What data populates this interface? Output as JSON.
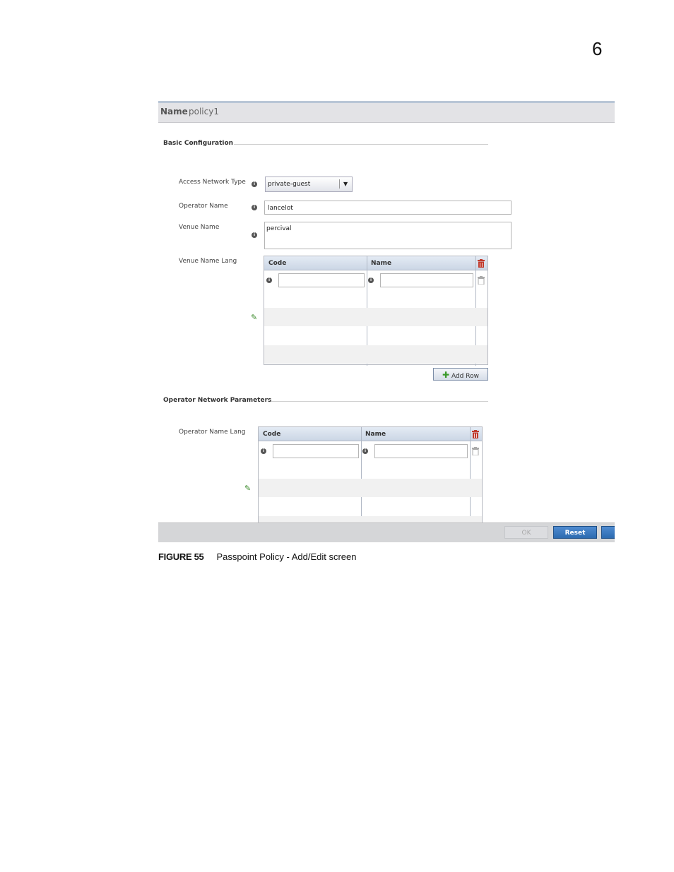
{
  "page": {
    "chapter_number": "6"
  },
  "dialog": {
    "name_label": "Name",
    "name_value": "policy1",
    "basic_config": {
      "title": "Basic Configuration",
      "access_network_type": {
        "label": "Access Network Type",
        "value": "private-guest"
      },
      "operator_name": {
        "label": "Operator Name",
        "value": "lancelot"
      },
      "venue_name": {
        "label": "Venue Name",
        "value": "percival"
      },
      "venue_name_lang": {
        "label": "Venue Name Lang",
        "columns": [
          "Code",
          "Name"
        ],
        "add_row_label": "Add Row"
      }
    },
    "operator_network": {
      "title": "Operator Network Parameters",
      "operator_name_lang": {
        "label": "Operator Name Lang",
        "columns": [
          "Code",
          "Name"
        ]
      }
    },
    "buttons": {
      "ok": "OK",
      "reset": "Reset"
    }
  },
  "caption": {
    "figure": "FIGURE 55",
    "text": "Passpoint Policy - Add/Edit screen"
  },
  "colors": {
    "trash_active": "#c0392b",
    "trash_disabled": "#aaaaaa",
    "pencil": "#3a8a2a",
    "button_blue": "#2d6bb0"
  },
  "icons": [
    "info-icon",
    "dropdown-arrow-icon",
    "trash-icon",
    "pencil-icon",
    "add-icon"
  ]
}
